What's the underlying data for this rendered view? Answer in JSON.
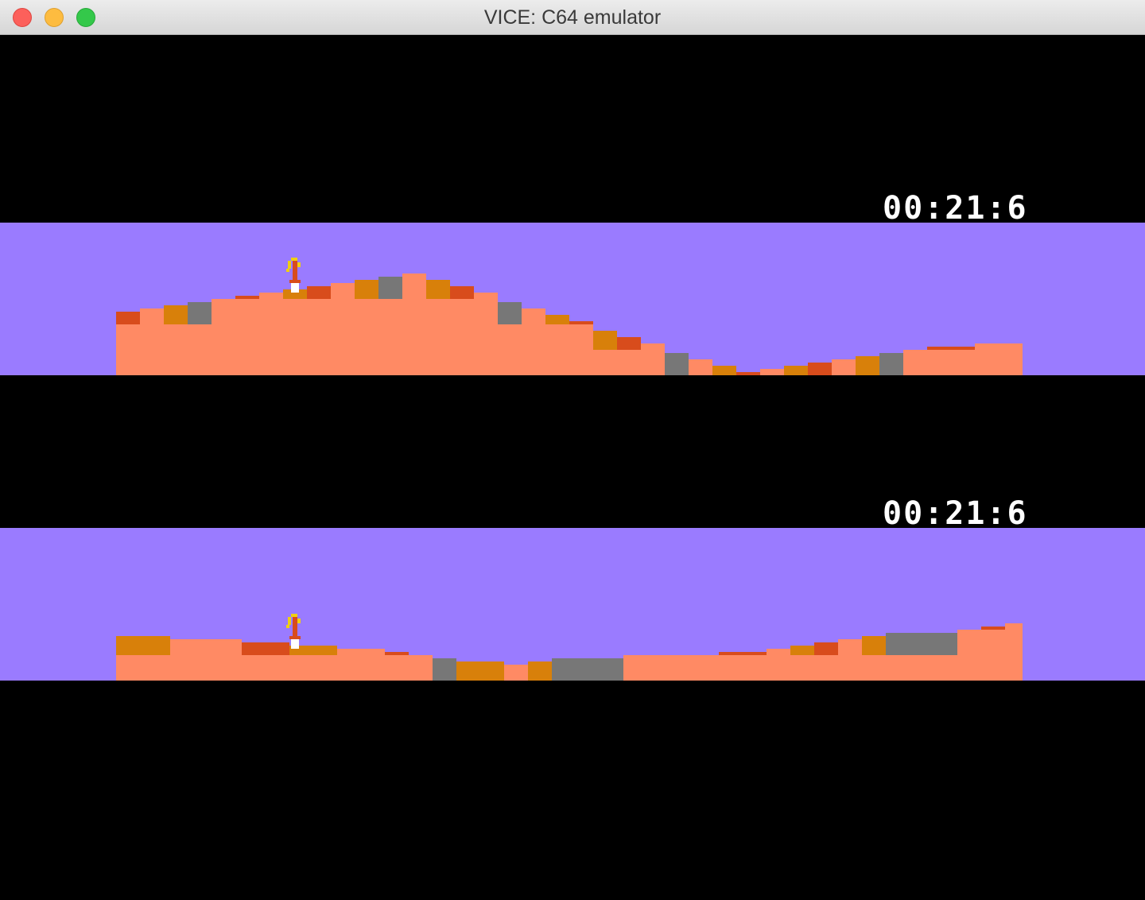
{
  "window": {
    "title": "VICE: C64 emulator"
  },
  "colors": {
    "sky": "#9a7bff",
    "ground": "#ff8a64",
    "orange": "#d8800a",
    "red": "#d84c1c",
    "gray": "#777777",
    "timer": "#ffffff"
  },
  "game": {
    "panels": [
      {
        "timer": "00:21:6"
      },
      {
        "timer": "00:21:6"
      }
    ]
  }
}
